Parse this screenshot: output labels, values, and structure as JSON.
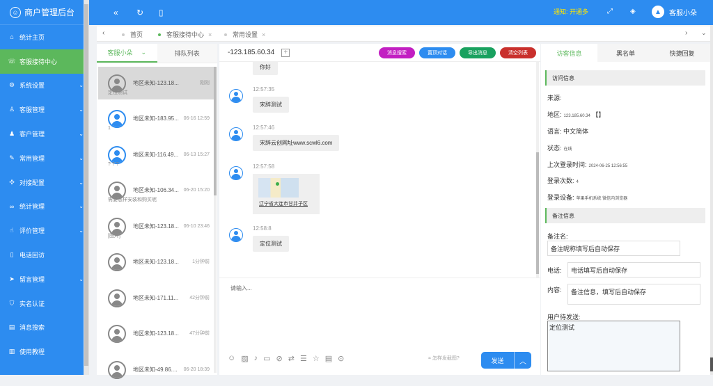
{
  "brand": {
    "title": "商户管理后台"
  },
  "sidebar": {
    "items": [
      {
        "label": "统计主页",
        "icon": "home-icon",
        "chev": false
      },
      {
        "label": "客服接待中心",
        "icon": "support-icon",
        "chev": false,
        "active": true
      },
      {
        "label": "系统设置",
        "icon": "gear-icon",
        "chev": true
      },
      {
        "label": "客服管理",
        "icon": "user-icon",
        "chev": true
      },
      {
        "label": "客户管理",
        "icon": "users-icon",
        "chev": true
      },
      {
        "label": "常用管理",
        "icon": "edit-icon",
        "chev": true
      },
      {
        "label": "对接配置",
        "icon": "plug-icon",
        "chev": true
      },
      {
        "label": "统计管理",
        "icon": "chart-icon",
        "chev": true
      },
      {
        "label": "评价管理",
        "icon": "thumb-icon",
        "chev": true
      },
      {
        "label": "电话回访",
        "icon": "phone-icon",
        "chev": false
      },
      {
        "label": "留言管理",
        "icon": "send-icon",
        "chev": true
      },
      {
        "label": "实名认证",
        "icon": "shield-icon",
        "chev": false
      },
      {
        "label": "消息搜索",
        "icon": "doc-icon",
        "chev": false
      },
      {
        "label": "使用教程",
        "icon": "book-icon",
        "chev": false
      }
    ]
  },
  "topbar": {
    "notice": "通知: 开通多",
    "user": "客服小朵"
  },
  "tabs": [
    {
      "label": "首页",
      "closable": false
    },
    {
      "label": "客服接待中心",
      "closable": true,
      "active": true
    },
    {
      "label": "常用设置",
      "closable": true
    }
  ],
  "left": {
    "tab_agent": "客服小朵",
    "tab_queue": "排队列表",
    "visitors": [
      {
        "name": "地区未知-123.18...",
        "time": "刚刚",
        "msg": "定位测试",
        "online": false,
        "active": true
      },
      {
        "name": "地区未知-183.95...",
        "time": "06-16 12:59",
        "msg": "1",
        "online": true
      },
      {
        "name": "地区未知-116.49...",
        "time": "06-13 15:27",
        "msg": "? ? ?",
        "online": true
      },
      {
        "name": "地区未知-106.34...",
        "time": "06-20 15:20",
        "msg": "需要怎样安装和购买呢",
        "online": false
      },
      {
        "name": "地区未知-123.18...",
        "time": "06-10 23:46",
        "msg": "[图片]",
        "online": false
      },
      {
        "name": "地区未知-123.18...",
        "time": "1分钟前",
        "msg": "",
        "online": false
      },
      {
        "name": "地区未知-171.11...",
        "time": "42分钟前",
        "msg": "",
        "online": false
      },
      {
        "name": "地区未知-123.18...",
        "time": "47分钟前",
        "msg": "",
        "online": false
      },
      {
        "name": "地区未知-49.86....",
        "time": "06-20 18:39",
        "msg": "",
        "online": false
      }
    ]
  },
  "chat": {
    "visitor_ip": "-123.185.60.34",
    "buttons": [
      {
        "label": "消息搜索",
        "color": "#c21fc2"
      },
      {
        "label": "置顶对话",
        "color": "#2d8cf0"
      },
      {
        "label": "导出消息",
        "color": "#19a15f"
      },
      {
        "label": "清空列表",
        "color": "#c9302c"
      }
    ],
    "messages": [
      {
        "time": "",
        "text": "你好"
      },
      {
        "time": "12:57:35",
        "text": "宋辞测试"
      },
      {
        "time": "12:57:46",
        "text": "宋辞云创网址www.scwl6.com"
      },
      {
        "time": "12:57:58",
        "text": "",
        "map": "辽宁省大连市甘井子区"
      },
      {
        "time": "12:58:8",
        "text": "定位测试"
      }
    ],
    "input_placeholder": "请输入...",
    "screenshot_hint": "怎样发截图?",
    "send_label": "发送"
  },
  "right": {
    "tabs": [
      "访客信息",
      "黑名单",
      "快捷回复"
    ],
    "section_visit": "访问信息",
    "source_label": "来源:",
    "region_label": "地区:",
    "region_value": "123.185.60.34",
    "region_bracket": "【】",
    "lang_label": "语言:",
    "lang_value": "中文简体",
    "status_label": "状态:",
    "status_value": "在线",
    "lastlogin_label": "上次登录时间:",
    "lastlogin_value": "2024-06-25 12:56:55",
    "logins_label": "登录次数:",
    "logins_value": "4",
    "device_label": "登录设备:",
    "device_value": "苹果手机系统 微信内浏览器",
    "section_note": "备注信息",
    "note_name_label": "备注名:",
    "note_name_ph": "备注昵称填写后自动保存",
    "phone_label": "电话:",
    "phone_ph": "电话填写后自动保存",
    "content_label": "内容:",
    "content_ph": "备注信息，填写后自动保存",
    "pending_label": "用户待发送:",
    "pending_value": "定位测试"
  }
}
